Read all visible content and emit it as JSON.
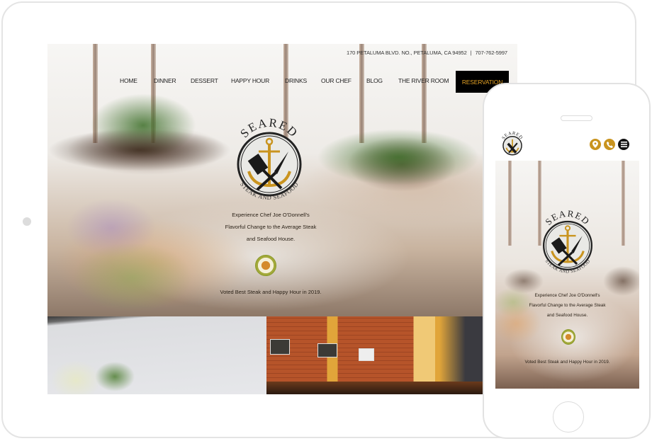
{
  "site": {
    "brand": "SEARED",
    "brand_sub": "STEAK AND SEAFOOD",
    "accent_color": "#e3a124",
    "gold_color": "#c9941f"
  },
  "tablet": {
    "topbar": {
      "address": "170 PETALUMA BLVD. NO., PETALUMA, CA 94952",
      "separator": "|",
      "phone": "707-762-5997"
    },
    "nav": {
      "items": [
        {
          "label": "HOME"
        },
        {
          "label": "DINNER"
        },
        {
          "label": "DESSERT"
        },
        {
          "label": "HAPPY HOUR"
        },
        {
          "label": "DRINKS"
        },
        {
          "label": "OUR CHEF"
        },
        {
          "label": "BLOG"
        },
        {
          "label": "THE RIVER ROOM"
        }
      ],
      "cta": "RESERVATION"
    },
    "hero": {
      "tagline_lines": [
        "Experience Chef Joe O'Donnell's",
        "Flavorful Change to the Average Steak",
        "and Seafood House."
      ],
      "award_badge": "award-badge-icon",
      "voted": "Voted Best Steak and Happy Hour in 2019."
    }
  },
  "phone": {
    "header_icons": [
      {
        "name": "location-pin-icon",
        "color": "#c9941f"
      },
      {
        "name": "phone-icon",
        "color": "#c9941f"
      },
      {
        "name": "menu-icon",
        "color": "#111111"
      }
    ],
    "hero": {
      "tagline_lines": [
        "Experience Chef Joe O'Donnell's",
        "Flavorful Change to the Average Steak",
        "and Seafood House."
      ],
      "voted": "Voted Best Steak and Happy Hour in 2019."
    }
  }
}
